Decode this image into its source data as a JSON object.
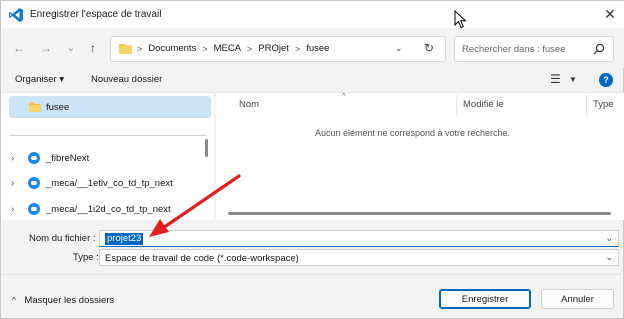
{
  "window": {
    "title": "Enregistrer l'espace de travail",
    "close_label": "✕"
  },
  "nav": {
    "back": "←",
    "forward": "→",
    "recent": "⌄",
    "up": "↑",
    "breadcrumbs": [
      "Documents",
      "MECA",
      "PROjet",
      "fusee"
    ],
    "separator": ">",
    "search_placeholder": "Rechercher dans : fusee"
  },
  "toolbar": {
    "organize_label": "Organiser ▾",
    "new_folder_label": "Nouveau dossier",
    "help_label": "?"
  },
  "sidebar": {
    "selected_folder": "fusee",
    "items": [
      {
        "label": "_fibreNext",
        "icon": "workspace-icon"
      },
      {
        "label": "_meca/__1etlv_co_td_tp_next",
        "icon": "workspace-icon"
      },
      {
        "label": "_meca/__1i2d_co_td_tp_next",
        "icon": "workspace-icon"
      }
    ]
  },
  "file_list": {
    "columns": [
      "Nom",
      "Modifié le",
      "Type"
    ],
    "empty_message": "Aucun élément ne correspond à votre recherche."
  },
  "form": {
    "filename_label": "Nom du fichier :",
    "filename_value": "projet23",
    "type_label": "Type :",
    "type_value": "Espace de travail de code (*.code-workspace)"
  },
  "footer": {
    "hide_folders_label": "Masquer les dossiers",
    "save_label": "Enregistrer",
    "cancel_label": "Annuler"
  },
  "colors": {
    "accent": "#0067c0",
    "selection": "#cce4f7",
    "annotation_arrow": "#e02020",
    "folder": "#f4c542"
  }
}
